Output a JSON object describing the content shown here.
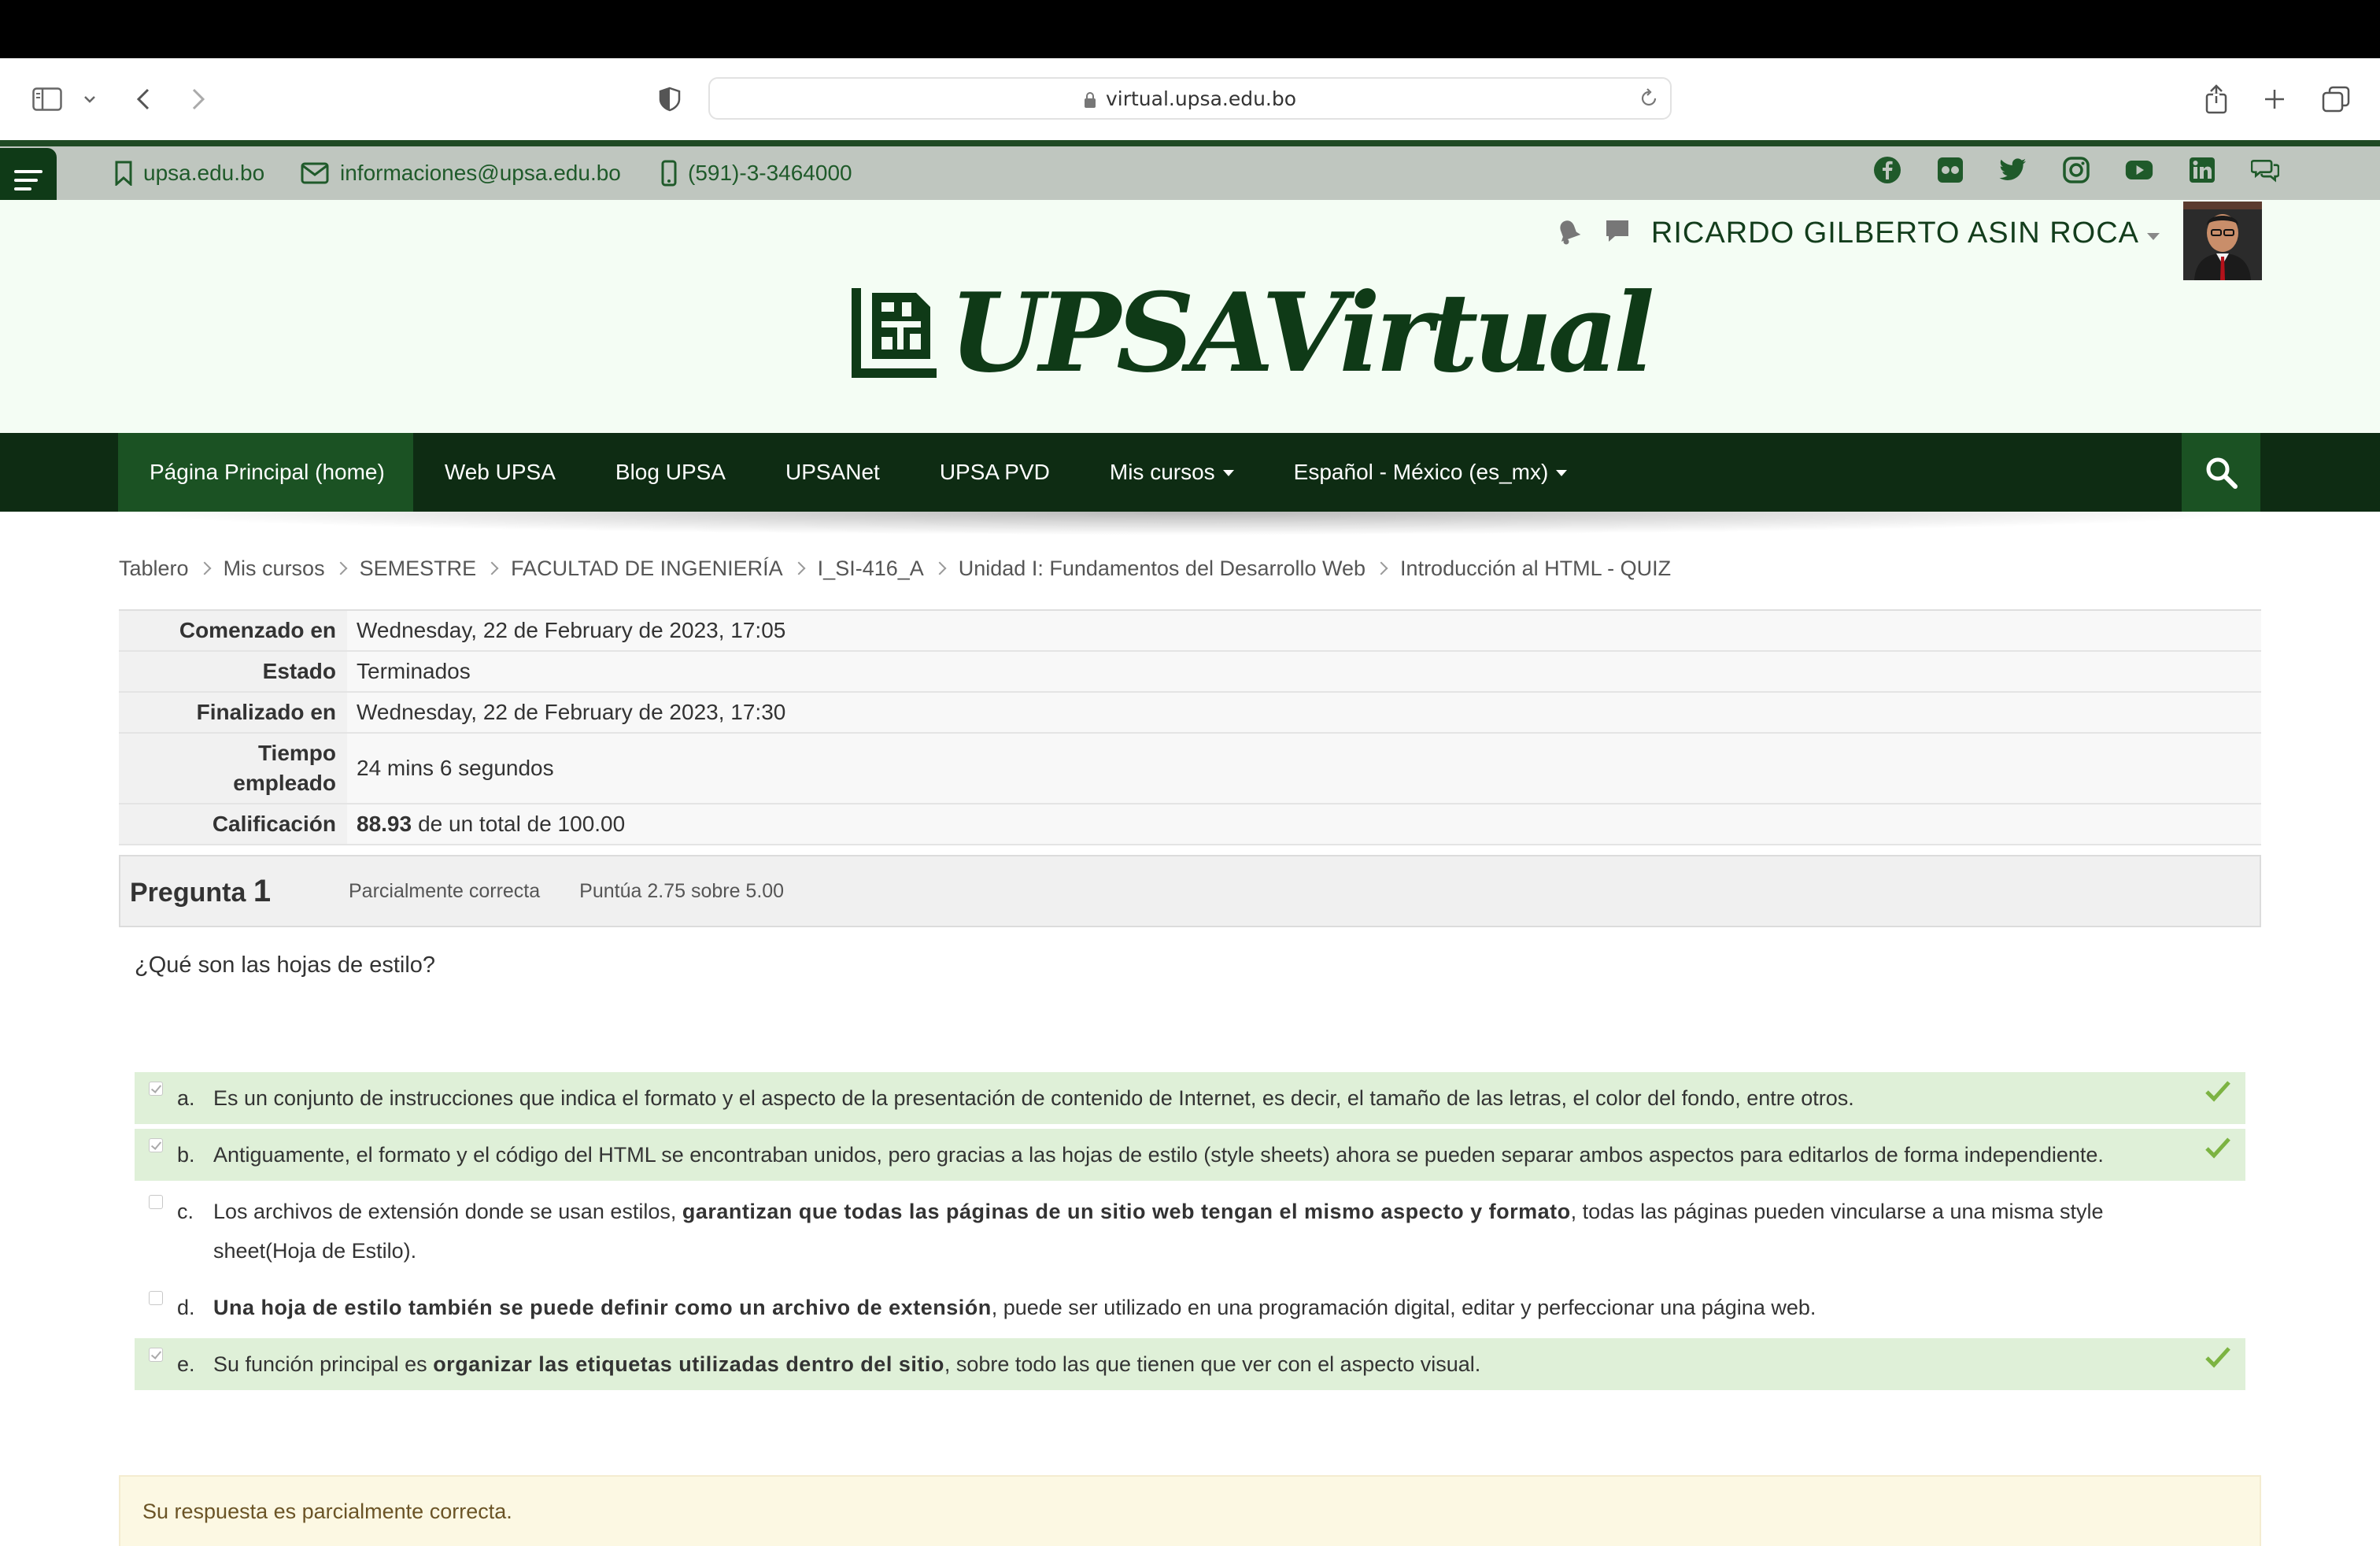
{
  "browser": {
    "url": "virtual.upsa.edu.bo"
  },
  "contact": {
    "website": "upsa.edu.bo",
    "email": "informaciones@upsa.edu.bo",
    "phone": "(591)-3-3464000"
  },
  "socials": [
    "facebook-icon",
    "flickr-icon",
    "twitter-icon",
    "instagram-icon",
    "youtube-icon",
    "linkedin-icon",
    "chat-icon"
  ],
  "user": {
    "name": "RICARDO GILBERTO ASIN ROCA"
  },
  "logo": {
    "text": "UPSAVirtual"
  },
  "nav": {
    "items": [
      {
        "label": "Página Principal (home)"
      },
      {
        "label": "Web UPSA"
      },
      {
        "label": "Blog UPSA"
      },
      {
        "label": "UPSANet"
      },
      {
        "label": "UPSA PVD"
      },
      {
        "label": "Mis cursos"
      },
      {
        "label": "Español - México (es_mx)"
      }
    ]
  },
  "breadcrumb": [
    "Tablero",
    "Mis cursos",
    "SEMESTRE",
    "FACULTAD DE INGENIERÍA",
    "I_SI-416_A",
    "Unidad I: Fundamentos del Desarrollo Web",
    "Introducción al HTML - QUIZ"
  ],
  "summary": {
    "started_label": "Comenzado en",
    "started_value": "Wednesday, 22 de February de 2023, 17:05",
    "state_label": "Estado",
    "state_value": "Terminados",
    "finished_label": "Finalizado en",
    "finished_value": "Wednesday, 22 de February de 2023, 17:30",
    "time_label_1": "Tiempo",
    "time_label_2": "empleado",
    "time_value": "24 mins 6 segundos",
    "grade_label": "Calificación",
    "grade_value": "88.93",
    "grade_suffix": "de un total de 100.00"
  },
  "question": {
    "title": "Pregunta",
    "number": "1",
    "state": "Parcialmente correcta",
    "grade": "Puntúa 2.75 sobre 5.00",
    "text": "¿Qué son las hojas de estilo?",
    "answers": {
      "a": {
        "letter": "a.",
        "text": "Es un conjunto de instrucciones que indica el formato y el aspecto de la presentación de contenido de Internet, es decir, el tamaño de las letras, el color del fondo, entre otros."
      },
      "b": {
        "letter": "b.",
        "text": "Antiguamente, el formato y el código del HTML se encontraban unidos, pero gracias a las hojas de estilo (style sheets) ahora se pueden separar ambos aspectos para editarlos de forma independiente."
      },
      "c": {
        "letter": "c.",
        "pre": "Los archivos de extensión donde se usan estilos,",
        "bold": "garantizan que todas las páginas de un sitio web tengan el mismo aspecto y formato",
        "post": ", todas las páginas pueden vincularse a una misma style sheet(Hoja de Estilo)."
      },
      "d": {
        "letter": "d.",
        "bold": "Una hoja de estilo también se puede definir como un archivo de extensión",
        "post": ", puede ser utilizado en una programación digital, editar y perfeccionar una página web."
      },
      "e": {
        "letter": "e.",
        "pre": "Su función principal es",
        "bold": "organizar las etiquetas utilizadas dentro del sitio",
        "post": ", sobre todo las que tienen que ver con el aspecto visual."
      }
    },
    "feedback": "Su respuesta es parcialmente correcta."
  },
  "colors": {
    "brand_dark": "#0e2c13",
    "brand": "#1b5223",
    "correct_bg": "#dff0d8",
    "tick": "#7cb342",
    "feedback_bg": "#fcf8e3"
  }
}
